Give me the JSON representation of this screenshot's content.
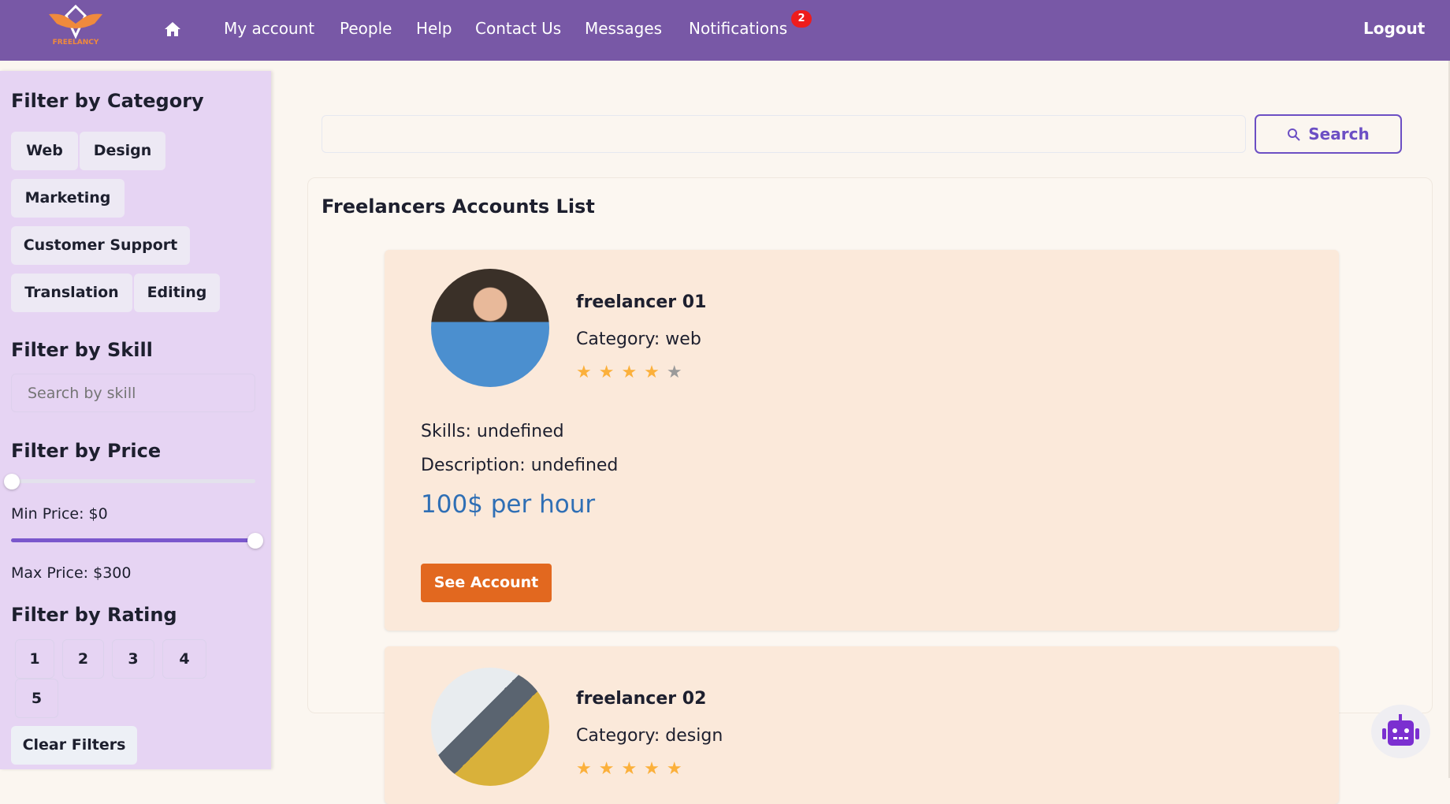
{
  "header": {
    "logo_text": "FREELANCY",
    "nav": [
      "My account",
      "People",
      "Help",
      "Contact Us",
      "Messages",
      "Notifications"
    ],
    "notification_count": "2",
    "logout": "Logout"
  },
  "sidebar": {
    "category_title": "Filter by Category",
    "categories": [
      "Web",
      "Design",
      "Marketing",
      "Customer Support",
      "Translation",
      "Editing"
    ],
    "skill_title": "Filter by Skill",
    "skill_placeholder": "Search by skill",
    "price_title": "Filter by Price",
    "min_price": "Min Price: $0",
    "max_price": "Max Price: $300",
    "min_value": 0,
    "max_value": 300,
    "price_range": [
      0,
      300
    ],
    "rating_title": "Filter by Rating",
    "ratings": [
      "1",
      "2",
      "3",
      "4",
      "5"
    ],
    "clear": "Clear Filters"
  },
  "search": {
    "value": "",
    "button": "Search"
  },
  "main": {
    "title": "Freelancers Accounts List",
    "cards": [
      {
        "name": "freelancer 01",
        "category": "Category: web",
        "rating": 4,
        "skills": "Skills: undefined",
        "description": "Description: undefined",
        "price": "100$ per hour",
        "button": "See Account"
      },
      {
        "name": "freelancer 02",
        "category": "Category: design",
        "rating": 5
      }
    ]
  },
  "colors": {
    "header": "#7858a6",
    "sidebar": "#e6d4f3",
    "accent": "#6c4fc4",
    "button": "#e2681f",
    "price": "#2f6fb5",
    "star": "#fbb03b",
    "star_empty": "#9a9a9a"
  }
}
